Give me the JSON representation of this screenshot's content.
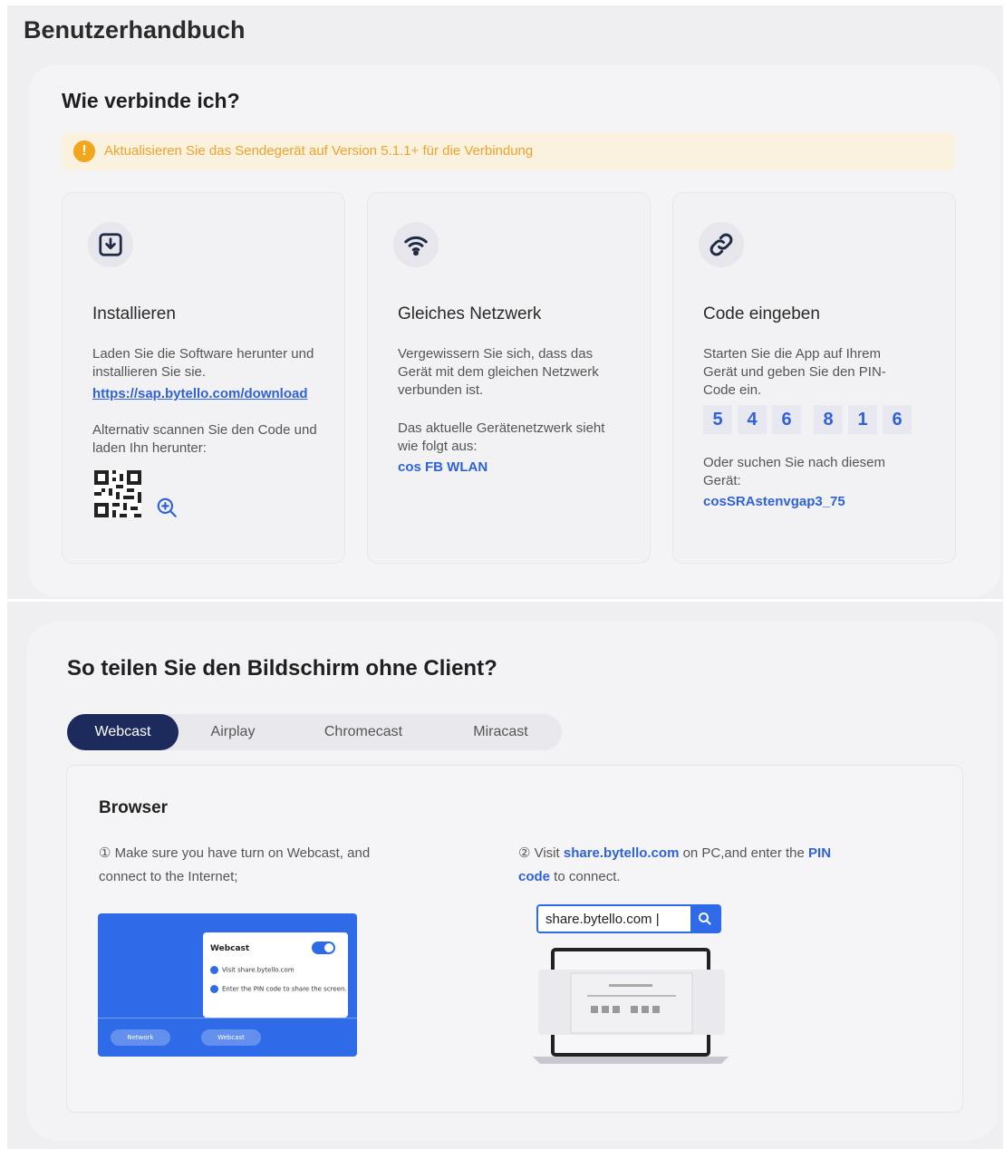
{
  "page": {
    "title": "Benutzerhandbuch"
  },
  "connect": {
    "title": "Wie verbinde ich?",
    "warning": "Aktualisieren Sie das Sendegerät auf Version 5.1.1+ für die Verbindung",
    "steps": [
      {
        "icon": "download-icon",
        "title": "Installieren",
        "text": "Laden Sie die Software herunter und installieren Sie sie.",
        "link": "https://sap.bytello.com/download",
        "alt_text": "Alternativ scannen Sie den Code und laden Ihn herunter:",
        "qr_icon": "qr-code-icon",
        "zoom_icon": "zoom-in-icon"
      },
      {
        "icon": "wifi-icon",
        "title": "Gleiches Netzwerk",
        "text": "Vergewissern Sie sich, dass das Gerät mit dem gleichen Netzwerk verbunden ist.",
        "network_label": "Das aktuelle Gerätenetzwerk sieht wie folgt aus:",
        "network_name": "cos FB WLAN"
      },
      {
        "icon": "link-icon",
        "title": "Code eingeben",
        "text": "Starten Sie die App auf Ihrem Gerät und geben Sie den PIN-Code ein.",
        "pin": [
          "5",
          "4",
          "6",
          "8",
          "1",
          "6"
        ],
        "device_label": "Oder suchen Sie nach diesem Gerät:",
        "device_name": "cosSRAstenvgap3_75"
      }
    ]
  },
  "share": {
    "title": "So teilen Sie den Bildschirm ohne Client?",
    "tabs": [
      {
        "label": "Webcast",
        "active": true
      },
      {
        "label": "Airplay",
        "active": false
      },
      {
        "label": "Chromecast",
        "active": false
      },
      {
        "label": "Miracast",
        "active": false
      }
    ],
    "browser": {
      "title": "Browser",
      "step1": "① Make sure you have turn on Webcast, and connect to the Internet;",
      "step2_pre": "② Visit ",
      "step2_link": "share.bytello.com",
      "step2_mid": " on PC,and enter the ",
      "step2_pin": "PIN code",
      "step2_post": " to connect.",
      "url_value": "share.bytello.com |",
      "illustration": {
        "popup_title": "Webcast",
        "line1": "Visit share.bytello.com",
        "line2": "Enter the PIN code to share the screen.",
        "pill_left": "Network",
        "pill_right": "Webcast"
      }
    }
  },
  "colors": {
    "accent": "#2f62d8",
    "warning": "#f3a51b",
    "tab_active": "#1d2b5c",
    "illustration_blue": "#2f6be8"
  }
}
